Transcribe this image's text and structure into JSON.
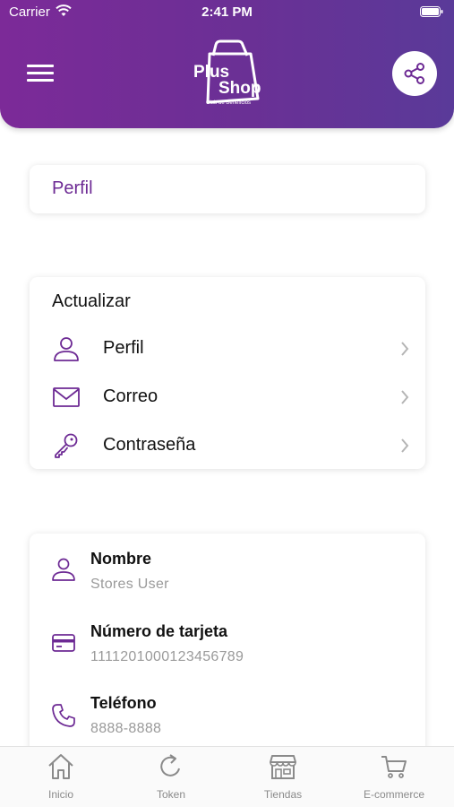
{
  "status_bar": {
    "carrier": "Carrier",
    "time": "2:41 PM"
  },
  "header": {
    "logo": {
      "line1": "Plus",
      "line2": "Shop",
      "tagline": "Club de Beneficios"
    },
    "accent_color": "#6d2a94"
  },
  "perfil_card": {
    "title": "Perfil"
  },
  "update_card": {
    "title": "Actualizar",
    "items": [
      {
        "icon": "person-icon",
        "label": "Perfil"
      },
      {
        "icon": "mail-icon",
        "label": "Correo"
      },
      {
        "icon": "key-icon",
        "label": "Contraseña"
      }
    ]
  },
  "info_card": {
    "fields": [
      {
        "icon": "person-icon",
        "label": "Nombre",
        "value": "Stores User"
      },
      {
        "icon": "card-icon",
        "label": "Número de tarjeta",
        "value": "1111201000123456789"
      },
      {
        "icon": "phone-icon",
        "label": "Teléfono",
        "value": "8888-8888"
      }
    ]
  },
  "tab_bar": {
    "tabs": [
      {
        "icon": "home-icon",
        "label": "Inicio"
      },
      {
        "icon": "refresh-icon",
        "label": "Token"
      },
      {
        "icon": "store-icon",
        "label": "Tiendas"
      },
      {
        "icon": "cart-icon",
        "label": "E-commerce"
      }
    ]
  }
}
